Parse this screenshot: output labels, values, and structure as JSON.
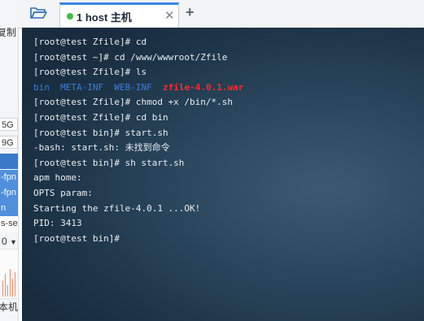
{
  "left_panel": {
    "text_top": "复制",
    "field_1": "5G",
    "field_2": "9G",
    "list_items": [
      "-fpn",
      "-fpn",
      "n",
      "s-se"
    ],
    "selector_value": "0",
    "bottom_label": "本机"
  },
  "toolbar": {
    "folder_icon": "folder-icon",
    "add_tab_label": "+"
  },
  "tab": {
    "label": "1 host 主机",
    "status_color": "#3fbf3f",
    "close_label": "✕"
  },
  "terminal": {
    "lines": [
      "[root@test Zfile]# cd",
      "[root@test ~]# cd /www/wwwroot/Zfile",
      "[root@test Zfile]# ls",
      "",
      "[root@test Zfile]# chmod +x /bin/*.sh",
      "[root@test Zfile]# cd bin",
      "[root@test bin]# start.sh",
      "-bash: start.sh: 未找到命令",
      "[root@test bin]# sh start.sh",
      "apm home:",
      "OPTS param:",
      "Starting the zfile-4.0.1 ...OK!",
      "PID: 3413",
      "[root@test bin]# "
    ],
    "ls_output": [
      {
        "name": "bin",
        "color": "#3b7de0"
      },
      {
        "name": "META-INF",
        "color": "#3b7de0"
      },
      {
        "name": "WEB-INF",
        "color": "#3b7de0"
      },
      {
        "name": "zfile-4.0.1.war",
        "color": "#ff2b2b"
      }
    ]
  }
}
